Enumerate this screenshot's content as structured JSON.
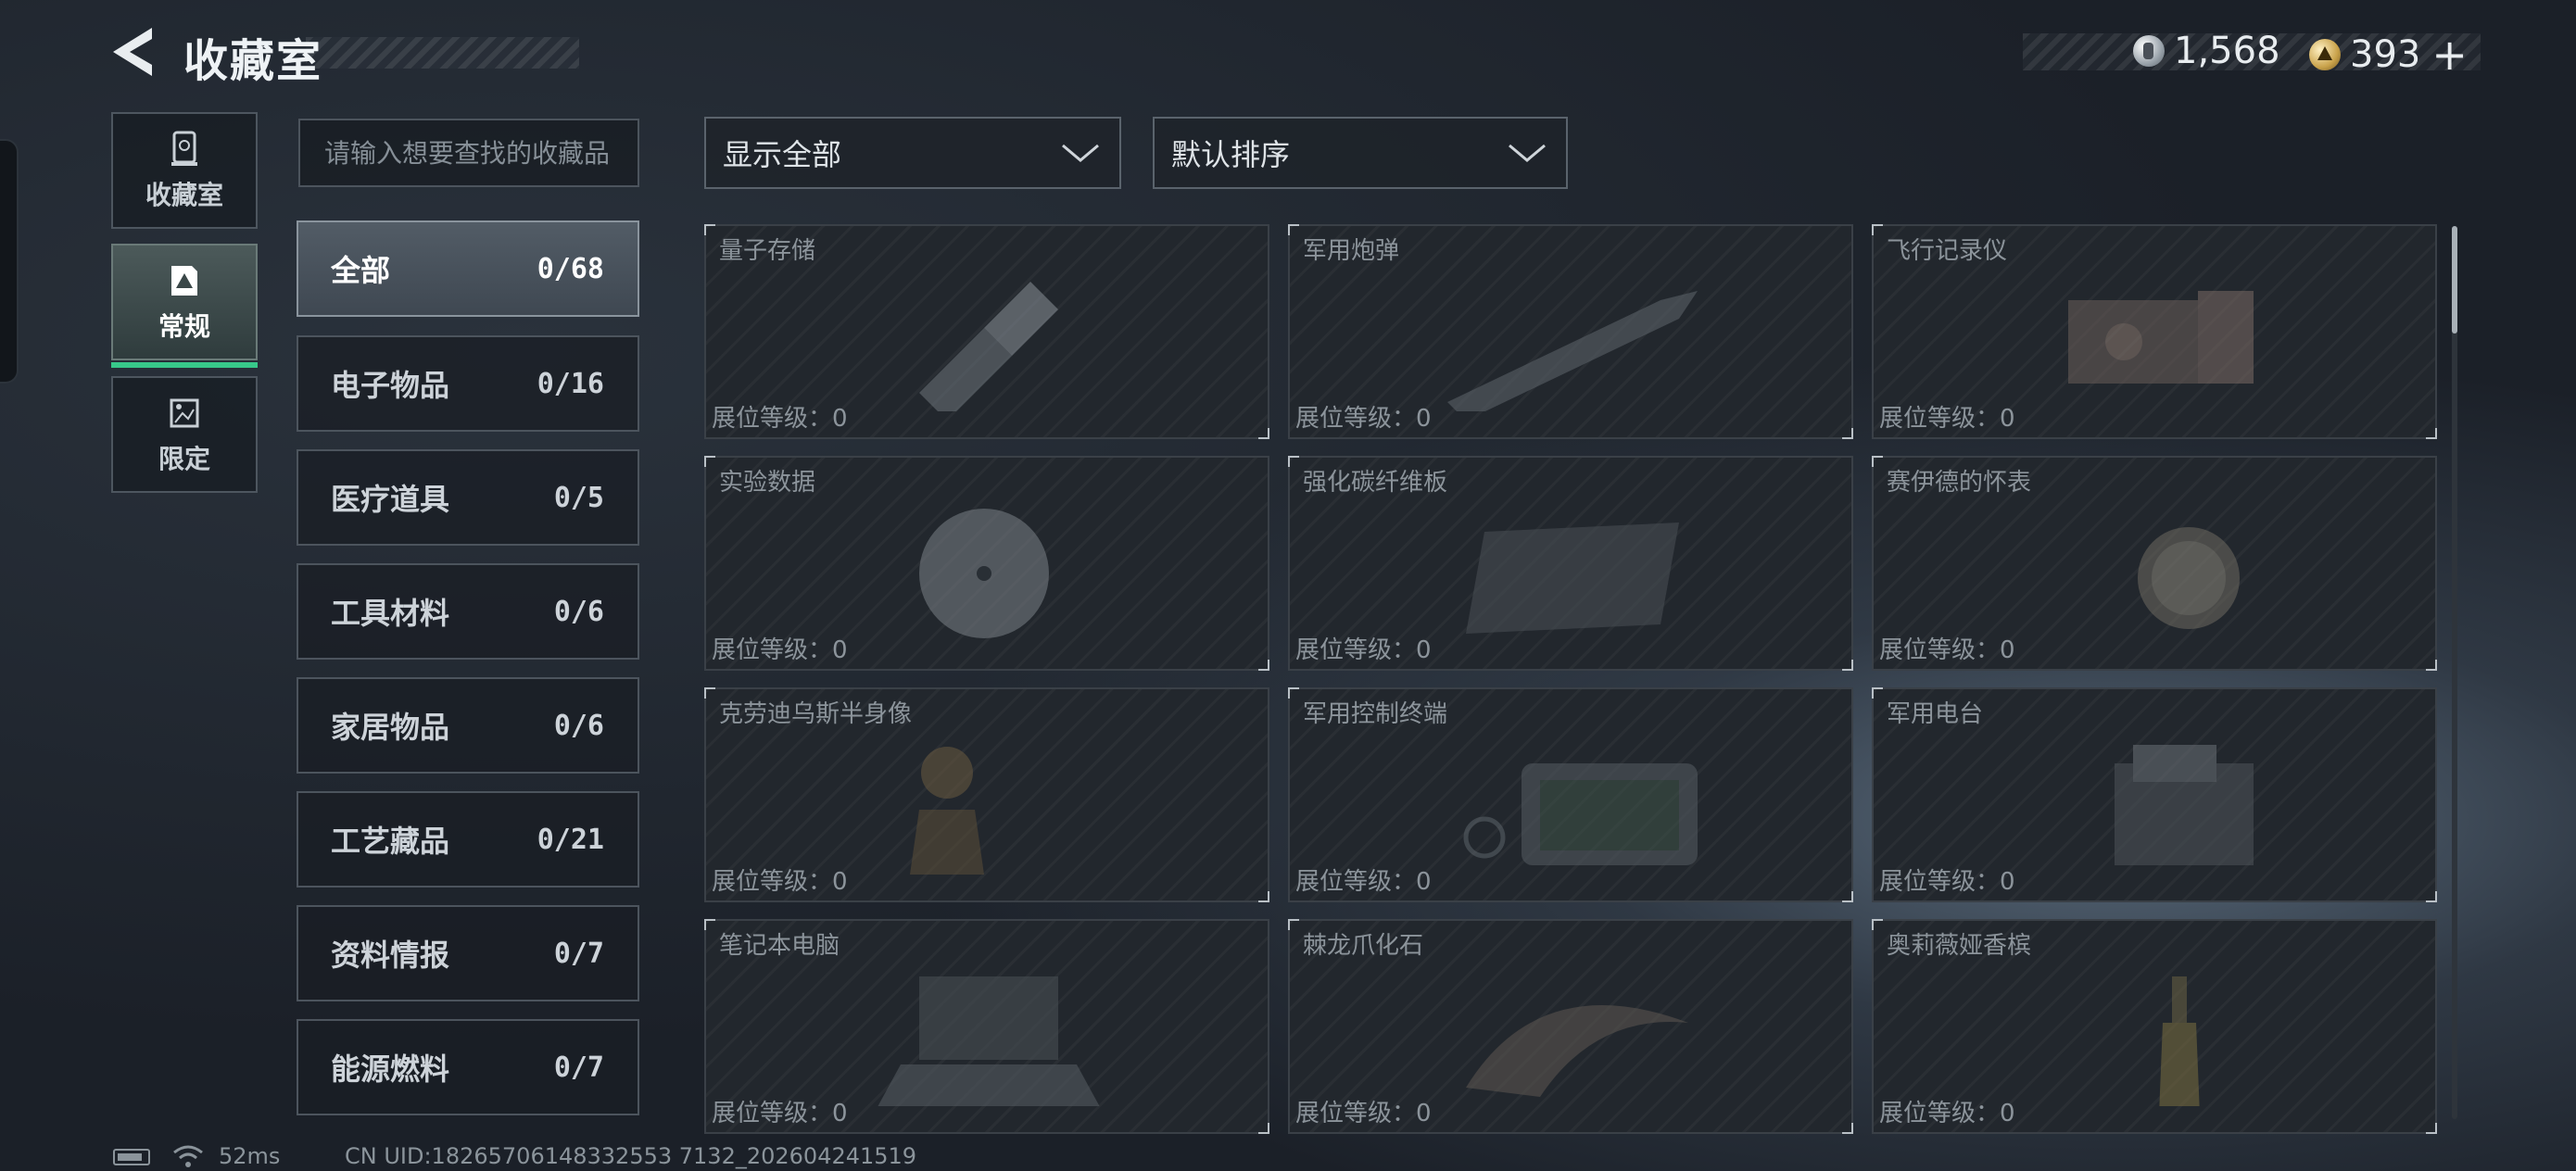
{
  "header": {
    "title": "收藏室",
    "currency_silver": "1,568",
    "currency_gold": "393",
    "plus": "+"
  },
  "side_nav": [
    {
      "label": "收藏室",
      "icon": "trophy-icon"
    },
    {
      "label": "常规",
      "icon": "collection-icon",
      "active": true
    },
    {
      "label": "限定",
      "icon": "gallery-icon"
    }
  ],
  "search": {
    "placeholder": "请输入想要查找的收藏品"
  },
  "filters": {
    "display": "显示全部",
    "sort": "默认排序"
  },
  "categories": [
    {
      "name": "全部",
      "count": "0/68",
      "active": true
    },
    {
      "name": "电子物品",
      "count": "0/16"
    },
    {
      "name": "医疗道具",
      "count": "0/5"
    },
    {
      "name": "工具材料",
      "count": "0/6"
    },
    {
      "name": "家居物品",
      "count": "0/6"
    },
    {
      "name": "工艺藏品",
      "count": "0/21"
    },
    {
      "name": "资料情报",
      "count": "0/7"
    },
    {
      "name": "能源燃料",
      "count": "0/7"
    }
  ],
  "items": [
    {
      "name": "量子存储",
      "level": "展位等级：0"
    },
    {
      "name": "军用炮弹",
      "level": "展位等级：0"
    },
    {
      "name": "飞行记录仪",
      "level": "展位等级：0"
    },
    {
      "name": "实验数据",
      "level": "展位等级：0"
    },
    {
      "name": "强化碳纤维板",
      "level": "展位等级：0"
    },
    {
      "name": "赛伊德的怀表",
      "level": "展位等级：0"
    },
    {
      "name": "克劳迪乌斯半身像",
      "level": "展位等级：0"
    },
    {
      "name": "军用控制终端",
      "level": "展位等级：0"
    },
    {
      "name": "军用电台",
      "level": "展位等级：0"
    },
    {
      "name": "笔记本电脑",
      "level": "展位等级：0"
    },
    {
      "name": "棘龙爪化石",
      "level": "展位等级：0"
    },
    {
      "name": "奥莉薇娅香槟",
      "level": "展位等级：0"
    }
  ],
  "status_bar": {
    "ping": "52ms",
    "uid": "CN UID:18265706148332553 7132_202604241519"
  },
  "colors": {
    "accent": "#37c88a",
    "panel": "#22272d",
    "border": "#4c545d"
  }
}
